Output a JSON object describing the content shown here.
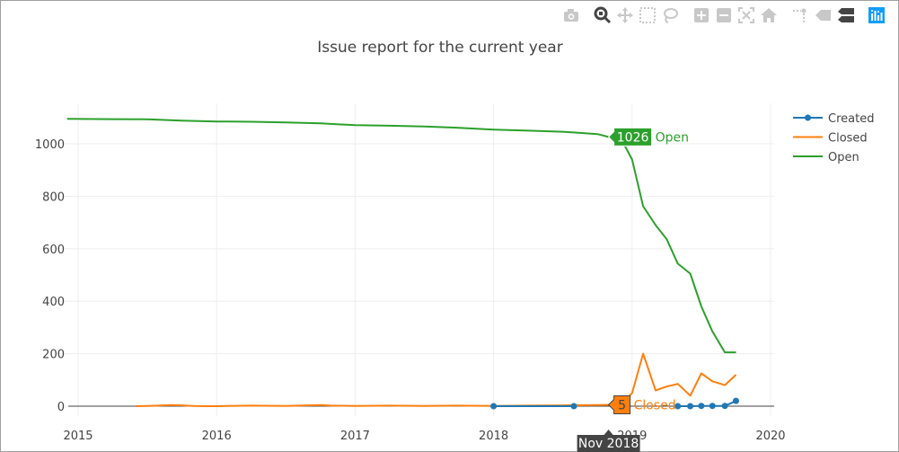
{
  "modebar": {
    "buttons": [
      {
        "name": "camera-icon",
        "title": "Download plot as a png"
      },
      {
        "name": "zoom-icon",
        "title": "Zoom",
        "active": true
      },
      {
        "name": "pan-icon",
        "title": "Pan"
      },
      {
        "name": "box-select-icon",
        "title": "Box Select"
      },
      {
        "name": "lasso-select-icon",
        "title": "Lasso Select"
      },
      {
        "name": "zoom-in-icon",
        "title": "Zoom in"
      },
      {
        "name": "zoom-out-icon",
        "title": "Zoom out"
      },
      {
        "name": "autoscale-icon",
        "title": "Autoscale"
      },
      {
        "name": "reset-axes-icon",
        "title": "Reset axes"
      },
      {
        "name": "spike-lines-icon",
        "title": "Toggle Spike Lines"
      },
      {
        "name": "hover-closest-icon",
        "title": "Show closest data on hover"
      },
      {
        "name": "hover-compare-icon",
        "title": "Compare data on hover"
      },
      {
        "name": "plotly-logo-icon",
        "title": "Produced with Plotly"
      }
    ]
  },
  "chart_data": {
    "type": "line",
    "title": "Issue report for the current year",
    "xlabel": "",
    "ylabel": "",
    "xlim": [
      2014.92,
      2020.1
    ],
    "ylim": [
      -40,
      1130
    ],
    "x_ticks": [
      "2015",
      "2016",
      "2017",
      "2018",
      "2019",
      "2020"
    ],
    "y_ticks": [
      "0",
      "200",
      "400",
      "600",
      "800",
      "1000"
    ],
    "grid": true,
    "legend": {
      "placement": "top-right",
      "entries": [
        "Created",
        "Closed",
        "Open"
      ]
    },
    "colors": {
      "Created": "#1f77b4",
      "Closed": "#ff7f0e",
      "Open": "#2ca02c"
    },
    "series": [
      {
        "name": "Created",
        "mode": "lines+markers",
        "x": [
          2018.0,
          2018.58,
          2019.33,
          2019.42,
          2019.5,
          2019.58,
          2019.67,
          2019.75
        ],
        "y": [
          0,
          0,
          0,
          0,
          1,
          1,
          1,
          20
        ],
        "segments": [
          [
            0,
            1
          ],
          [
            2,
            7
          ]
        ]
      },
      {
        "name": "Closed",
        "mode": "lines",
        "x": [
          2015.42,
          2015.5,
          2015.58,
          2015.67,
          2015.75,
          2015.83,
          2015.92,
          2016.0,
          2016.25,
          2016.5,
          2016.75,
          2016.83,
          2017.0,
          2017.25,
          2017.5,
          2017.75,
          2018.0,
          2018.25,
          2018.5,
          2018.75,
          2018.83,
          2018.92,
          2019.0,
          2019.08,
          2019.17,
          2019.25,
          2019.33,
          2019.42,
          2019.5,
          2019.58,
          2019.67,
          2019.75
        ],
        "y": [
          0,
          1,
          2,
          4,
          3,
          1,
          0,
          0,
          2,
          1,
          4,
          2,
          1,
          2,
          1,
          2,
          1,
          2,
          3,
          4,
          5,
          5,
          50,
          200,
          60,
          75,
          85,
          40,
          125,
          95,
          80,
          120
        ]
      },
      {
        "name": "Open",
        "mode": "lines",
        "x": [
          2014.92,
          2015.25,
          2015.5,
          2015.75,
          2016.0,
          2016.25,
          2016.5,
          2016.75,
          2017.0,
          2017.25,
          2017.5,
          2017.75,
          2018.0,
          2018.25,
          2018.5,
          2018.75,
          2018.83,
          2018.92,
          2019.0,
          2019.08,
          2019.17,
          2019.25,
          2019.33,
          2019.42,
          2019.5,
          2019.58,
          2019.67,
          2019.75
        ],
        "y": [
          1095,
          1094,
          1093,
          1088,
          1085,
          1084,
          1081,
          1078,
          1071,
          1069,
          1066,
          1061,
          1054,
          1050,
          1046,
          1037,
          1026,
          1020,
          940,
          762,
          690,
          636,
          543,
          505,
          380,
          285,
          205,
          205
        ]
      }
    ],
    "hover": {
      "x_label": "Nov 2018",
      "x": 2018.83,
      "points": [
        {
          "series": "Open",
          "value": "1026",
          "label": "Open",
          "y": 1026
        },
        {
          "series": "Closed",
          "value": "5",
          "label": "Closed",
          "y": 5
        }
      ]
    }
  }
}
